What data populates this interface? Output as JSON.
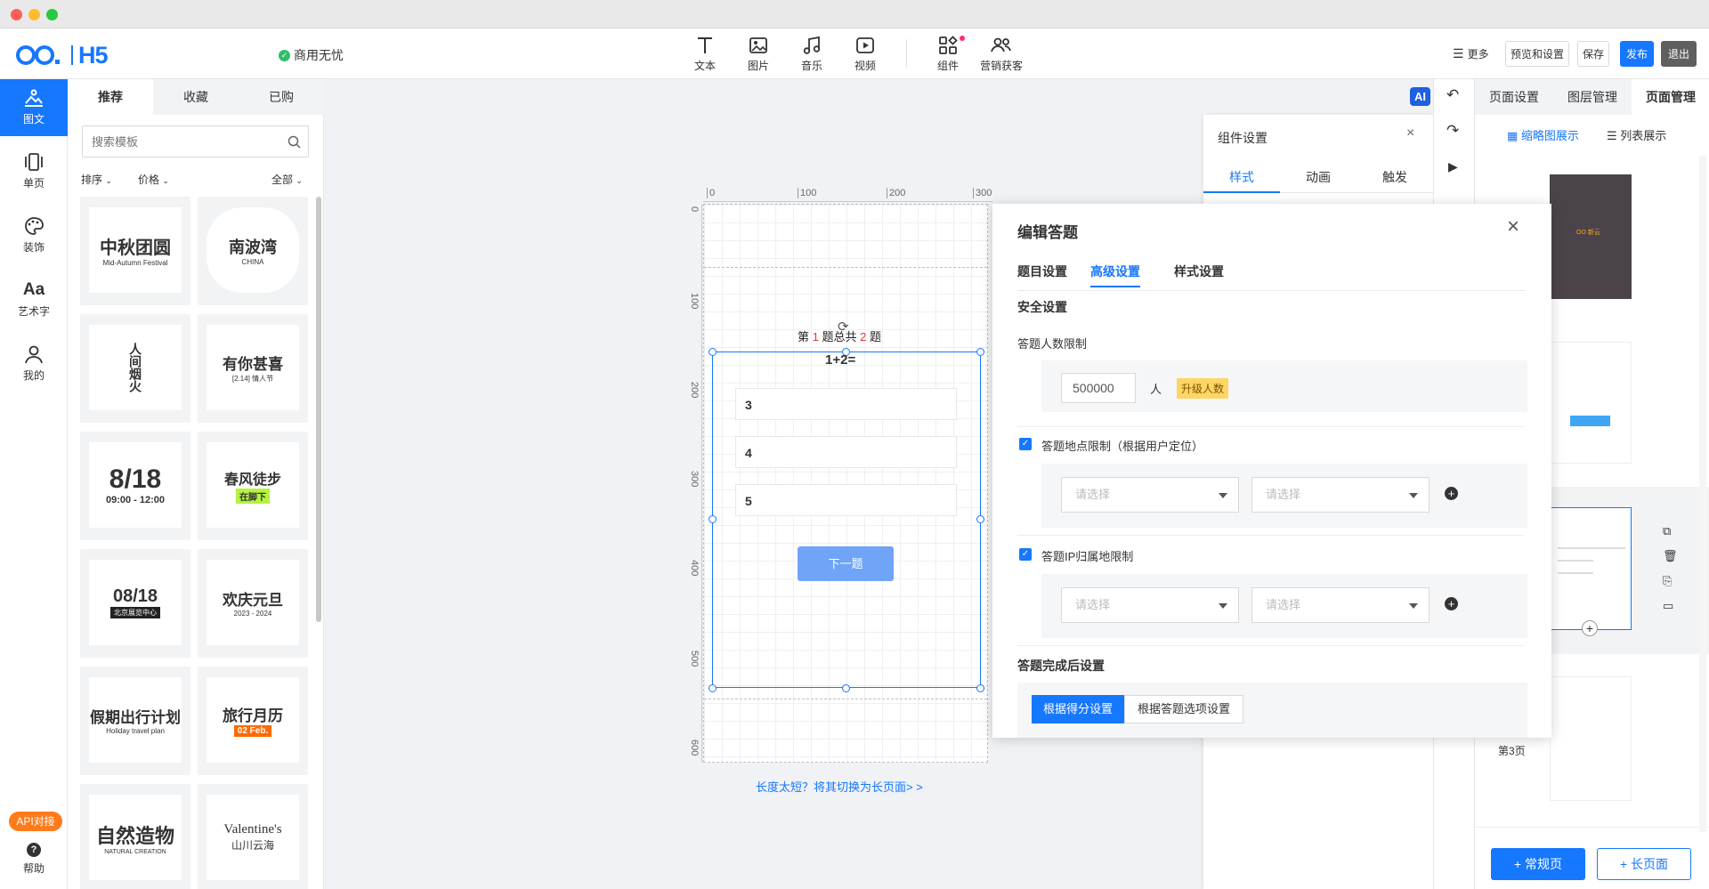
{
  "header": {
    "logo": "H5",
    "badge": "商用无忧",
    "tools": [
      {
        "label": "文本",
        "icon": "text-icon"
      },
      {
        "label": "图片",
        "icon": "image-icon"
      },
      {
        "label": "音乐",
        "icon": "music-icon"
      },
      {
        "label": "视频",
        "icon": "video-icon"
      },
      {
        "label": "组件",
        "icon": "component-icon"
      },
      {
        "label": "营销获客",
        "icon": "users-icon"
      }
    ],
    "more": "更多",
    "preview": "预览和设置",
    "save": "保存",
    "publish": "发布",
    "exit": "退出"
  },
  "leftnav": {
    "items": [
      {
        "label": "图文",
        "icon": "image-text-icon"
      },
      {
        "label": "单页",
        "icon": "single-page-icon"
      },
      {
        "label": "装饰",
        "icon": "palette-icon"
      },
      {
        "label": "艺术字",
        "icon": "art-text-icon"
      },
      {
        "label": "我的",
        "icon": "user-icon"
      }
    ],
    "api": "API对接",
    "help": "帮助"
  },
  "templates": {
    "tabs": [
      "推荐",
      "收藏",
      "已购"
    ],
    "search_placeholder": "搜索模板",
    "filters": {
      "sort": "排序",
      "price": "价格",
      "all": "全部"
    },
    "cards": [
      {
        "line1": "中秋团圆",
        "line2": "Mid-Autumn Festival"
      },
      {
        "line1": "南波湾",
        "line2": "CHINA"
      },
      {
        "line1": "人间烟火",
        "line2": ""
      },
      {
        "line1": "有你甚喜",
        "line2": "[2.14] 情人节"
      },
      {
        "line1": "8/18",
        "line2": "09:00 - 12:00"
      },
      {
        "line1": "春风徒步",
        "line2": "在脚下"
      },
      {
        "line1": "08/18",
        "line2": "北京展览中心"
      },
      {
        "line1": "欢庆元旦",
        "line2": "2023 - 2024"
      },
      {
        "line1": "假期出行计划",
        "line2": "Holiday travel plan"
      },
      {
        "line1": "旅行月历",
        "line2": "02 Feb."
      },
      {
        "line1": "自然造物",
        "line2": "NATURAL CREATION"
      },
      {
        "line1": "Valentine's",
        "line2": "山川云海"
      }
    ]
  },
  "canvas": {
    "ruler_top": [
      "0",
      "100",
      "200",
      "300"
    ],
    "ruler_left": [
      "0",
      "100",
      "200",
      "300",
      "400",
      "500",
      "600"
    ],
    "progress_prefix": "第",
    "progress_current": "1",
    "progress_mid": "题总共",
    "progress_total": "2",
    "progress_suffix": "题",
    "question": "1+2=",
    "options": [
      "3",
      "4",
      "5"
    ],
    "next_button": "下一题",
    "hint": "长度太短？将其切换为长页面> >"
  },
  "ai_label": "AI",
  "component_settings": {
    "title": "组件设置",
    "tabs": [
      "样式",
      "动画",
      "触发"
    ]
  },
  "dialog": {
    "title": "编辑答题",
    "tabs": [
      "题目设置",
      "高级设置",
      "样式设置"
    ],
    "security_title": "安全设置",
    "limit_label": "答题人数限制",
    "limit_value": "500000",
    "limit_unit": "人",
    "upgrade": "升级人数",
    "location_label": "答题地点限制（根据用户定位）",
    "ip_label": "答题IP归属地限制",
    "select_placeholder": "请选择",
    "after_title": "答题完成后设置",
    "after_options": [
      "根据得分设置",
      "根据答题选项设置"
    ]
  },
  "pages": {
    "tabs": [
      "页面设置",
      "图层管理",
      "页面管理"
    ],
    "view_thumb": "缩略图展示",
    "view_list": "列表展示",
    "page3_label": "第3页",
    "add_normal": "+ 常规页",
    "add_long": "+ 长页面"
  }
}
